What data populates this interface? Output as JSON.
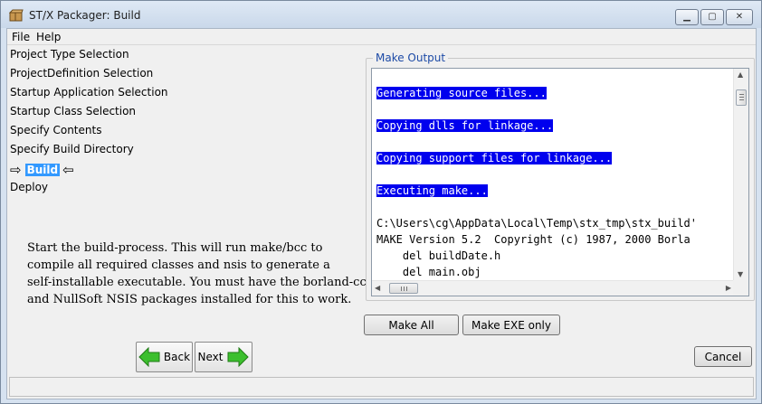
{
  "window": {
    "title": "ST/X Packager: Build",
    "controls": {
      "minimize": "▁",
      "maximize": "▢",
      "close": "✕"
    }
  },
  "menu": {
    "file": "File",
    "help": "Help"
  },
  "steps": [
    "Project Type Selection",
    "ProjectDefinition Selection",
    "Startup Application Selection",
    "Startup Class Selection",
    "Specify Contents",
    "Specify Build Directory",
    "Build",
    "Deploy"
  ],
  "current_step": {
    "label": "Build",
    "left_marker": "⇨",
    "right_marker": "⇦"
  },
  "description": [
    "Start the build-process. This will run make/bcc to",
    "compile all required classes and nsis to generate a",
    "self-installable executable. You must have the borland-cc",
    "and NullSoft NSIS packages installed for this to work."
  ],
  "output_panel": {
    "legend": "Make Output",
    "lines": [
      {
        "text": "Generating source files...",
        "highlight": true
      },
      {
        "text": "",
        "highlight": false
      },
      {
        "text": "Copying dlls for linkage...",
        "highlight": true
      },
      {
        "text": "",
        "highlight": false
      },
      {
        "text": "Copying support files for linkage...",
        "highlight": true
      },
      {
        "text": "",
        "highlight": false
      },
      {
        "text": "Executing make...",
        "highlight": true
      },
      {
        "text": "",
        "highlight": false
      },
      {
        "text": "C:\\Users\\cg\\AppData\\Local\\Temp\\stx_tmp\\stx_build'",
        "highlight": false
      },
      {
        "text": "MAKE Version 5.2  Copyright (c) 1987, 2000 Borla",
        "highlight": false
      },
      {
        "text": "    del buildDate.h",
        "highlight": false
      },
      {
        "text": "    del main.obj",
        "highlight": false
      }
    ]
  },
  "buttons": {
    "make_all": "Make All",
    "make_exe_only": "Make EXE only",
    "back": "Back",
    "next": "Next",
    "cancel": "Cancel"
  },
  "colors": {
    "selection": "#3399ff",
    "output_highlight": "#0000ee",
    "arrow_green": "#3cbf2e",
    "legend_text": "#1c4aa6"
  }
}
